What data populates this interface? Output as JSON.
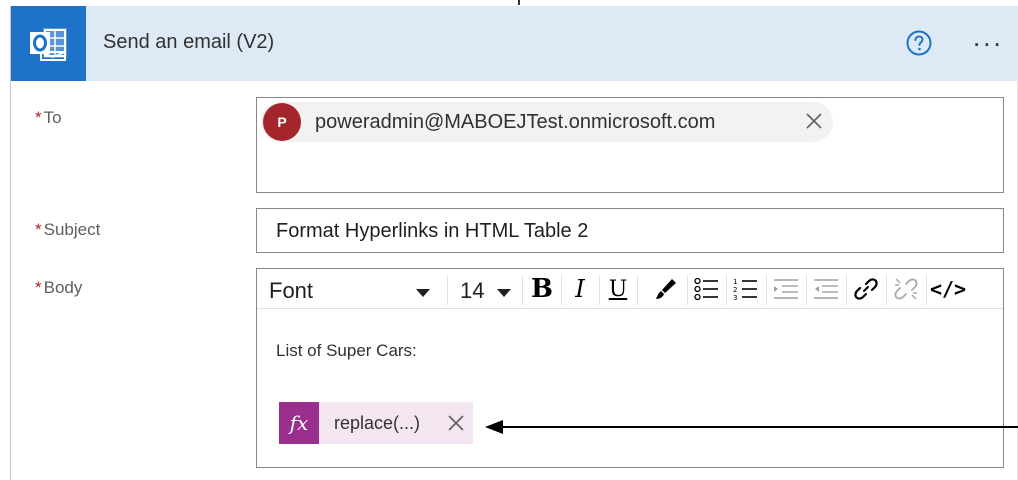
{
  "header": {
    "title": "Send an email (V2)",
    "app_icon": "outlook-icon",
    "help_icon": "help-circle-icon",
    "more_icon": "ellipsis-icon",
    "more_label": "...",
    "accent": "#1e72c8",
    "header_bg": "#dde9f5"
  },
  "fields": {
    "required_marker": "*",
    "to": {
      "label": "To",
      "recipient": {
        "initial": "P",
        "email": "poweradmin@MABOEJTest.onmicrosoft.com",
        "avatar_color": "#a4262c"
      }
    },
    "subject": {
      "label": "Subject",
      "value": "Format Hyperlinks in HTML Table 2"
    },
    "body": {
      "label": "Body",
      "toolbar": {
        "font": "Font",
        "size": "14",
        "bold": "B",
        "italic": "I",
        "underline": "U",
        "code": "</>",
        "icons": [
          "paint-brush-icon",
          "bulleted-list-icon",
          "numbered-list-icon",
          "indent-icon",
          "outdent-icon",
          "link-icon",
          "unlink-icon",
          "code-view-icon"
        ]
      },
      "text": "List of Super Cars:",
      "token": {
        "fx": "fx",
        "label": "replace(...)",
        "color": "#9b2f8e"
      }
    }
  }
}
